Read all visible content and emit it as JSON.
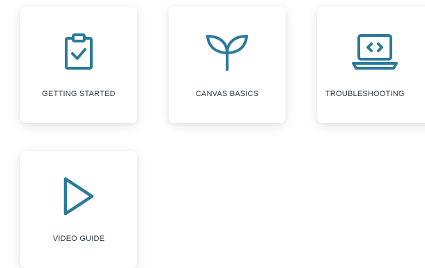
{
  "cards": [
    {
      "label": "GETTING STARTED",
      "icon": "clipboard-check-icon"
    },
    {
      "label": "CANVAS BASICS",
      "icon": "sprout-icon"
    },
    {
      "label": "TROUBLESHOOTING",
      "icon": "laptop-code-icon"
    },
    {
      "label": "VIDEO GUIDE",
      "icon": "play-icon"
    }
  ],
  "colors": {
    "icon": "#2b7a9b",
    "label": "#2d3b45",
    "card_bg": "#ffffff"
  }
}
